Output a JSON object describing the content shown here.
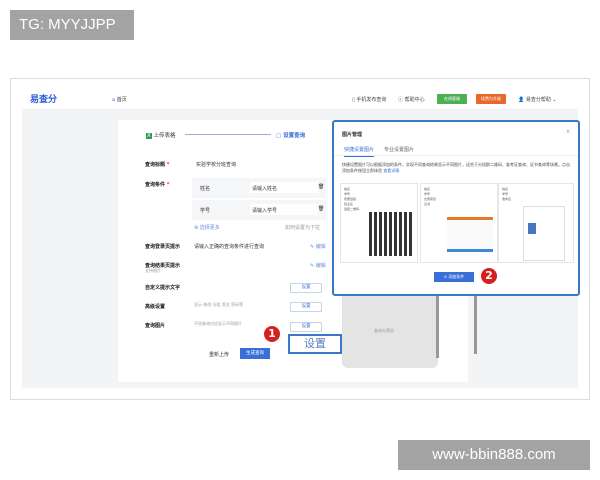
{
  "overlay": {
    "tag": "TG: MYYJJPP",
    "watermark": "www-bbin888.com"
  },
  "header": {
    "logo": "易查分",
    "home": "首页",
    "mobile": "手机发布查询",
    "help": "帮助中心",
    "online": "在线客服",
    "vip": "续费为升级",
    "user": "易查分帮助"
  },
  "steps": {
    "step1": "上传表格",
    "step2": "设置查询"
  },
  "form": {
    "title_label": "查询标题",
    "title_value": "实验学校分班查询",
    "cond_label": "查询条件",
    "conditions": [
      {
        "name": "姓名",
        "placeholder": "请输入姓名"
      },
      {
        "name": "学号",
        "placeholder": "请输入学号"
      }
    ],
    "select_more": "选择更多",
    "dropdown_hint": "如何设置为下拉",
    "login_tip_label": "查询登录页提示",
    "login_tip_value": "请输入正确的查询条件进行查询",
    "edit": "编辑",
    "result_tip_label": "查询结果页提示",
    "result_tip_sub": "支持图片",
    "custom_label": "自定义提示文字",
    "advanced_label": "高级设置",
    "advanced_value": "显示 修改 分组 签名 密码等",
    "image_label": "查询图片",
    "image_value": "不同查询对应显示不同图片",
    "set": "设置",
    "reupload": "重新上传",
    "generate": "生成查询"
  },
  "callout": {
    "label": "设置",
    "badge1": "1",
    "badge2": "2"
  },
  "phone": {
    "text": "查询分预览"
  },
  "modal": {
    "title": "图片管理",
    "close": "×",
    "tabs": [
      "快捷设置图片",
      "专业设置图片"
    ],
    "desc": "快捷设置图片可以根据添加的条件，实现不同查询结果显示不同图片，适合于分班群二维码、准考证查询、证书查询等场景。点击添加条件按钮立即体验",
    "link": "查看详情",
    "add": "添加条件",
    "samples": [
      [
        "姓名",
        "学号",
        "所属班级",
        "班主任",
        "班级二维码"
      ],
      [
        "姓名",
        "学号",
        "比赛项目",
        "证书"
      ],
      [
        "姓名",
        "学号",
        "准考证"
      ]
    ]
  }
}
